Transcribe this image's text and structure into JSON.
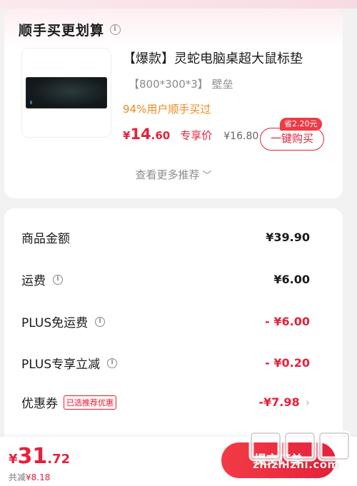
{
  "buy_together": {
    "title": "顺手买更划算",
    "product": {
      "title": "【爆款】灵蛇电脑桌超大鼠标垫",
      "spec": "【800*300*3】 壁垒",
      "tag": "94%用户顺手买过",
      "price_yen": "¥",
      "price_int": "14",
      "price_dec": ".60",
      "exclusive_label": "专享价",
      "original_price": "¥16.80",
      "save_badge": "省2.20元",
      "buy_button": "一键购买"
    },
    "more_recommend": "查看更多推荐"
  },
  "summary": {
    "rows": [
      {
        "label": "商品金额",
        "value": "¥39.90"
      },
      {
        "label": "运费",
        "value": "¥6.00"
      },
      {
        "label": "PLUS免运费",
        "value": "- ¥6.00"
      },
      {
        "label": "PLUS专享立减",
        "value": "- ¥0.20"
      },
      {
        "label": "优惠券",
        "tag": "已选推荐优惠",
        "value": "-¥7.98"
      }
    ]
  },
  "footer": {
    "total_yen": "¥",
    "total_int": "31",
    "total_dec": ".72",
    "saving_label": "共减",
    "saving_value": "¥8.18",
    "submit_button": "提交订单",
    "watermark": "zhizhizhi.com"
  },
  "colors": {
    "accent": "#e4223b",
    "tag_orange": "#f08a1e"
  }
}
